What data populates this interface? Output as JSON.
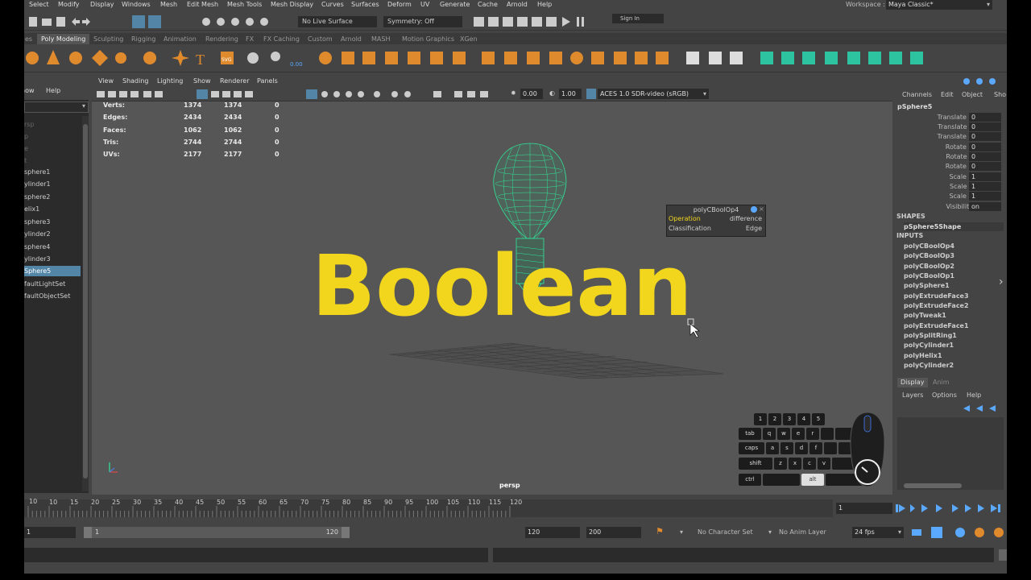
{
  "menubar": {
    "items": [
      "Select",
      "Modify",
      "Display",
      "Windows",
      "Mesh",
      "Edit Mesh",
      "Mesh Tools",
      "Mesh Display",
      "Curves",
      "Surfaces",
      "Deform",
      "UV",
      "Generate",
      "Cache",
      "Arnold",
      "Help"
    ],
    "workspace_label": "Workspace :",
    "workspace_value": "Maya Classic*"
  },
  "statusline": {
    "live_surface": "No Live Surface",
    "symmetry": "Symmetry: Off",
    "sign_in": "Sign In"
  },
  "shelf_tabs": [
    "es",
    "Poly Modeling",
    "Sculpting",
    "Rigging",
    "Animation",
    "Rendering",
    "FX",
    "FX Caching",
    "Custom",
    "Arnold",
    "MASH",
    "Motion Graphics",
    "XGen"
  ],
  "shelf_tabs_active": "Poly Modeling",
  "outliner": {
    "menu": [
      "how",
      "Help"
    ],
    "items": [
      "rsp",
      "p",
      "e",
      "t",
      "sphere1",
      "ylinder1",
      "sphere2",
      "elix1",
      "sphere3",
      "ylinder2",
      "sphere4",
      "ylinder3",
      "Sphere5",
      "faultLightSet",
      "faultObjectSet"
    ],
    "selected": "Sphere5"
  },
  "viewport": {
    "menu": [
      "View",
      "Shading",
      "Lighting",
      "Show",
      "Renderer",
      "Panels"
    ],
    "exposure": "0.00",
    "gamma": "1.00",
    "color_space": "ACES 1.0 SDR-video (sRGB)",
    "camera_label": "persp",
    "hud": [
      {
        "label": "Verts:",
        "a": "1374",
        "b": "1374",
        "c": "0"
      },
      {
        "label": "Edges:",
        "a": "2434",
        "b": "2434",
        "c": "0"
      },
      {
        "label": "Faces:",
        "a": "1062",
        "b": "1062",
        "c": "0"
      },
      {
        "label": "Tris:",
        "a": "2744",
        "b": "2744",
        "c": "0"
      },
      {
        "label": "UVs:",
        "a": "2177",
        "b": "2177",
        "c": "0"
      }
    ]
  },
  "overlay_title": "Boolean",
  "popup": {
    "title": "polyCBoolOp4",
    "rows": [
      {
        "label": "Operation",
        "value": "difference"
      },
      {
        "label": "Classification",
        "value": "Edge"
      }
    ]
  },
  "channelbox": {
    "menu": [
      "Channels",
      "Edit",
      "Object",
      "Sho"
    ],
    "object": "pSphere5",
    "attrs": [
      {
        "name": "Translate X",
        "value": "0"
      },
      {
        "name": "Translate Y",
        "value": "0"
      },
      {
        "name": "Translate Z",
        "value": "0"
      },
      {
        "name": "Rotate X",
        "value": "0"
      },
      {
        "name": "Rotate Y",
        "value": "0"
      },
      {
        "name": "Rotate Z",
        "value": "0"
      },
      {
        "name": "Scale X",
        "value": "1"
      },
      {
        "name": "Scale Y",
        "value": "1"
      },
      {
        "name": "Scale Z",
        "value": "1"
      },
      {
        "name": "Visibility",
        "value": "on"
      }
    ],
    "shapes_header": "SHAPES",
    "shape": "pSphere5Shape",
    "inputs_header": "INPUTS",
    "inputs": [
      "polyCBoolOp4",
      "polyCBoolOp3",
      "polyCBoolOp2",
      "polyCBoolOp1",
      "polySphere1",
      "polyExtrudeFace3",
      "polyExtrudeFace2",
      "polyTweak1",
      "polyExtrudeFace1",
      "polySplitRing1",
      "polyCylinder1",
      "polyHelix1",
      "polyCylinder2"
    ]
  },
  "layers": {
    "tabs": [
      "Display",
      "Anim"
    ],
    "menu": [
      "Layers",
      "Options",
      "Help"
    ]
  },
  "timeline": {
    "ticks": [
      "10",
      "15",
      "20",
      "25",
      "30",
      "35",
      "40",
      "45",
      "50",
      "55",
      "60",
      "65",
      "70",
      "75",
      "80",
      "85",
      "90",
      "95",
      "100",
      "105",
      "110",
      "115",
      "120"
    ],
    "current_frame": "1"
  },
  "rangebar": {
    "start": "1",
    "inner_start": "1",
    "inner_end": "120",
    "end": "120",
    "anim_end": "200",
    "character_set": "No Character Set",
    "anim_layer": "No Anim Layer",
    "fps": "24 fps"
  },
  "keyboard": {
    "rows": [
      [
        "1",
        "2",
        "3",
        "4",
        "5"
      ],
      [
        "tab",
        "q",
        "w",
        "e",
        "r"
      ],
      [
        "caps",
        "a",
        "s",
        "d",
        "f"
      ],
      [
        "shift",
        "z",
        "x",
        "c",
        "v"
      ],
      [
        "ctrl",
        "alt"
      ]
    ]
  },
  "colors": {
    "overlay": "#f2d51d",
    "wireframe": "#2ee89a",
    "selection": "#5285a6"
  }
}
